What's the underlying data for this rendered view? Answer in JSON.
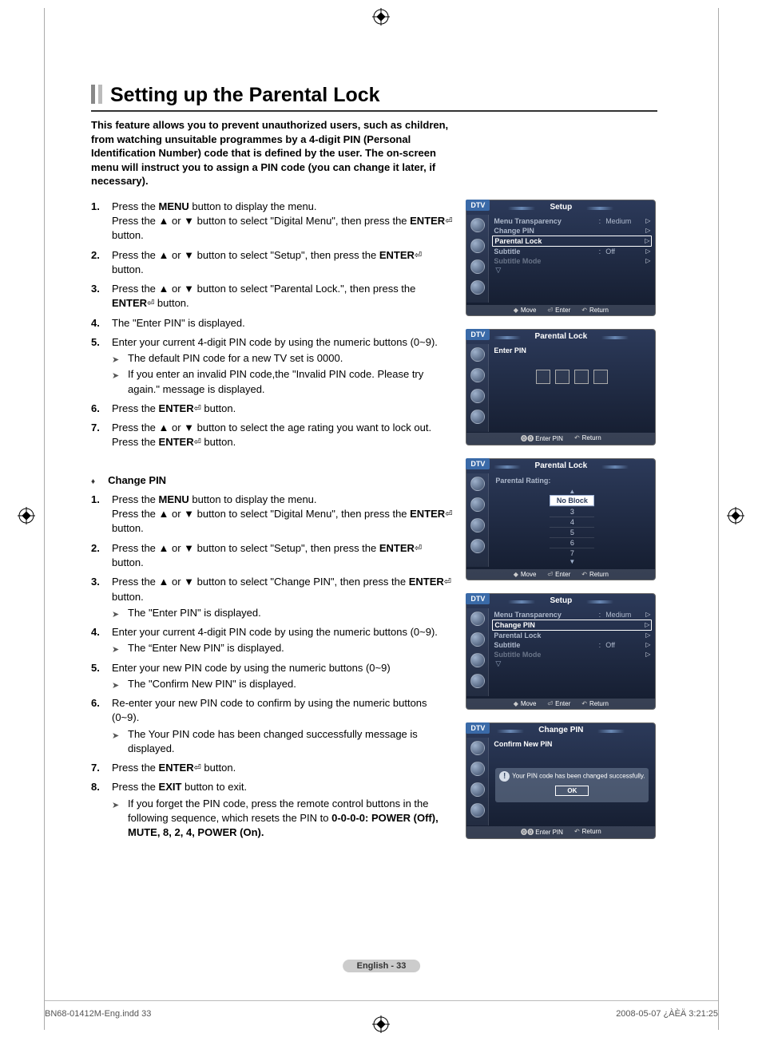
{
  "title": "Setting up the Parental Lock",
  "intro": "This feature allows you to prevent unauthorized users, such as children, from watching unsuitable programmes by a 4-digit PIN (Personal Identification Number) code that is defined by the user.  The on-screen menu will instruct you to assign a PIN code (you can change it later, if necessary).",
  "steps1": [
    {
      "n": "1.",
      "t": "Press the <b>MENU</b> button to display the menu.<br>Press the ▲ or ▼ button to select \"Digital Menu\", then press the <b>ENTER</b><span class='enter-icon'></span> button."
    },
    {
      "n": "2.",
      "t": "Press the ▲ or ▼ button to select \"Setup\", then press the <b>ENTER</b><span class='enter-icon'></span> button."
    },
    {
      "n": "3.",
      "t": "Press the ▲ or ▼ button to select \"Parental Lock.\", then press the <b>ENTER</b><span class='enter-icon'></span> button."
    },
    {
      "n": "4.",
      "t": "The \"Enter PIN\" is displayed."
    },
    {
      "n": "5.",
      "t": "Enter your current 4-digit PIN code by using the numeric buttons (0~9).",
      "subs": [
        "The default PIN code for a new TV set is 0000.",
        "If you enter an invalid PIN code,the \"Invalid PIN code. Please try again.\" message is displayed."
      ]
    },
    {
      "n": "6.",
      "t": "Press the <b>ENTER</b><span class='enter-icon'></span> button."
    },
    {
      "n": "7.",
      "t": "Press the ▲ or ▼ button to select the age rating you want to lock out.<br>Press the <b>ENTER</b><span class='enter-icon'></span> button."
    }
  ],
  "section2_hdr": "Change PIN",
  "steps2": [
    {
      "n": "1.",
      "t": "Press the <b>MENU</b> button to display the menu.<br>Press the ▲ or ▼ button to select \"Digital Menu\", then press the <b>ENTER</b><span class='enter-icon'></span> button."
    },
    {
      "n": "2.",
      "t": "Press the ▲ or ▼ button to select \"Setup\", then press the <b>ENTER</b><span class='enter-icon'></span> button."
    },
    {
      "n": "3.",
      "t": "Press the ▲ or ▼ button to select \"Change PIN\", then press the <b>ENTER</b><span class='enter-icon'></span> button.",
      "subs": [
        "The \"Enter PIN\" is displayed."
      ]
    },
    {
      "n": "4.",
      "t": "Enter your current 4-digit PIN code by using the numeric buttons (0~9).",
      "subs": [
        "The “Enter New PIN” is displayed."
      ]
    },
    {
      "n": "5.",
      "t": "Enter your new PIN code by using the numeric buttons (0~9)",
      "subs": [
        "The \"Confirm New PIN\" is displayed."
      ]
    },
    {
      "n": "6.",
      "t": "Re-enter your new PIN code to confirm by using the numeric buttons (0~9).",
      "subs": [
        "The Your PIN code has been changed successfully message is displayed."
      ]
    },
    {
      "n": "7.",
      "t": "Press the <b>ENTER</b><span class='enter-icon'></span> button."
    },
    {
      "n": "8.",
      "t": "Press the <b>EXIT</b> button to exit.",
      "subs": [
        "If you forget the PIN code, press the remote control buttons in the following sequence, which resets the PIN to <b>0-0-0-0: POWER (Off), MUTE, 8, 2, 4, POWER (On).</b>"
      ]
    }
  ],
  "osd": {
    "dtv": "DTV",
    "setup": "Setup",
    "parental_lock": "Parental Lock",
    "change_pin": "Change PIN",
    "menu_transparency": "Menu Transparency",
    "medium": "Medium",
    "subtitle": "Subtitle",
    "off": "Off",
    "subtitle_mode": "Subtitle  Mode",
    "enter_pin": "Enter PIN",
    "parental_rating": "Parental Rating:",
    "no_block": "No Block",
    "ratings": [
      "3",
      "4",
      "5",
      "6",
      "7"
    ],
    "confirm_new_pin": "Confirm New PIN",
    "success_msg": "Your PIN code has been changed successfully.",
    "ok": "OK",
    "footer": {
      "move": "Move",
      "enter": "Enter",
      "return": "Return",
      "enter_pin": "Enter PIN"
    }
  },
  "page_num": "English - 33",
  "footer_left": "BN68-01412M-Eng.indd   33",
  "footer_right": "2008-05-07   ¿ÀÈÄ 3:21:25"
}
